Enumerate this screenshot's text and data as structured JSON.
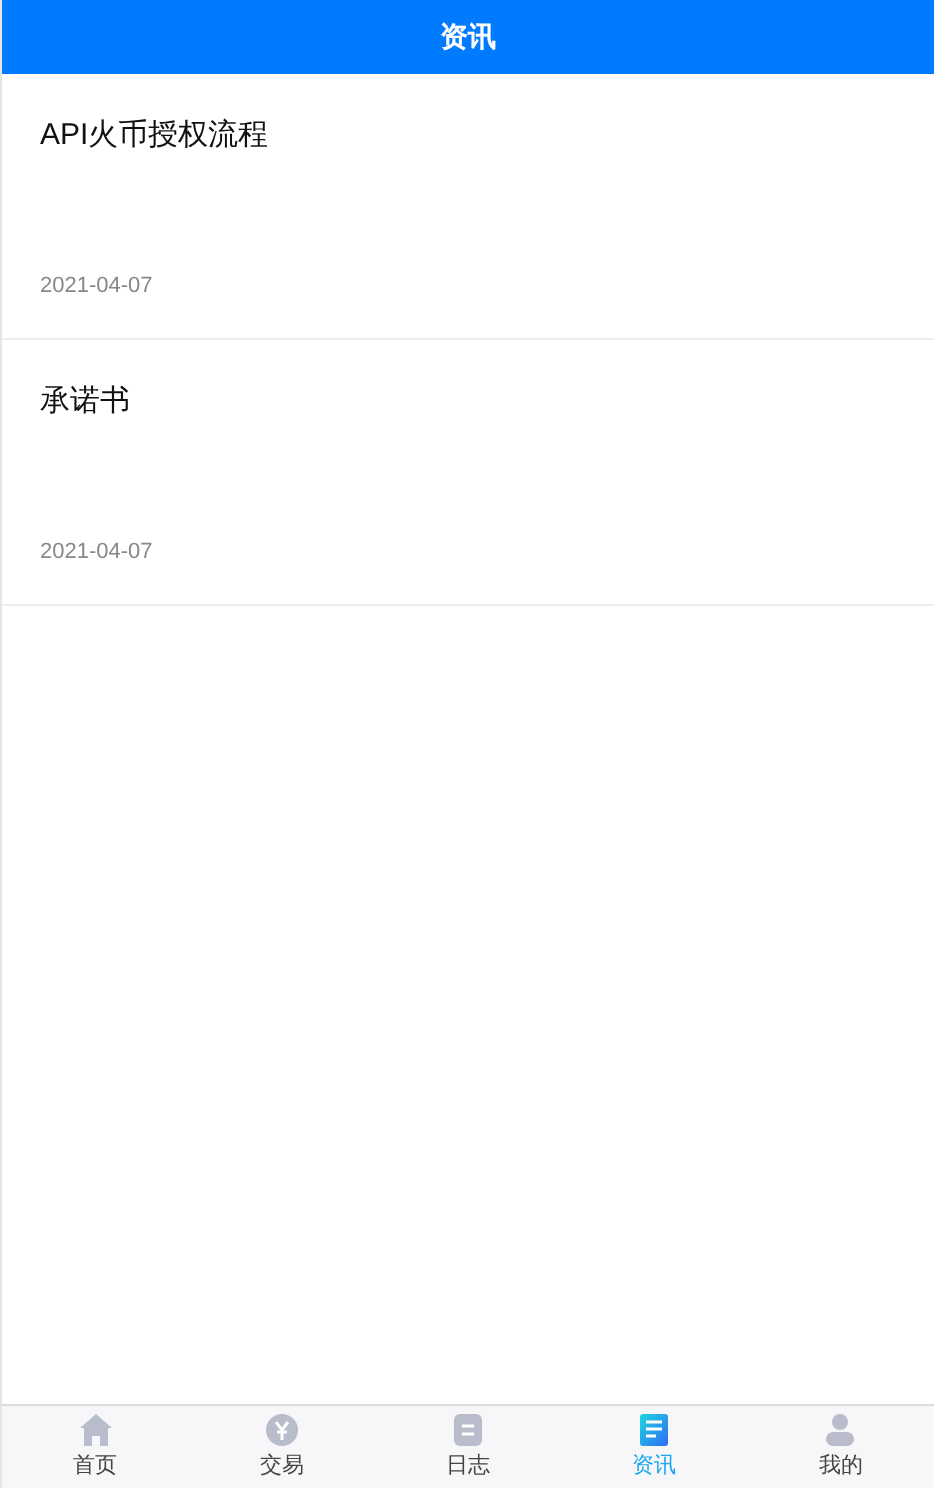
{
  "header": {
    "title": "资讯"
  },
  "articles": [
    {
      "title": "API火币授权流程",
      "date": "2021-04-07"
    },
    {
      "title": "承诺书",
      "date": "2021-04-07"
    }
  ],
  "tabbar": [
    {
      "kind": "home",
      "label": "首页",
      "selected": false
    },
    {
      "kind": "trade",
      "label": "交易",
      "selected": false
    },
    {
      "kind": "log",
      "label": "日志",
      "selected": false
    },
    {
      "kind": "news",
      "label": "资讯",
      "selected": true
    },
    {
      "kind": "me",
      "label": "我的",
      "selected": false
    }
  ]
}
